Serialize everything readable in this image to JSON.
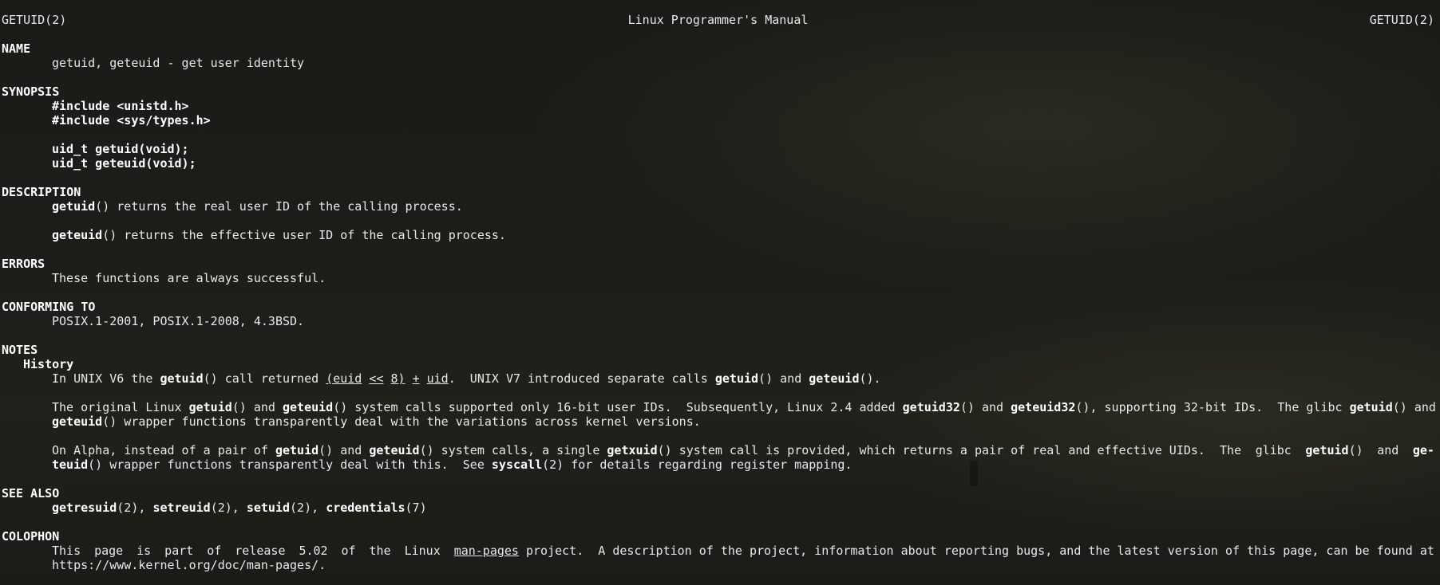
{
  "header": {
    "left": "GETUID(2)",
    "center": "Linux Programmer's Manual",
    "right": "GETUID(2)"
  },
  "name": {
    "title": "NAME",
    "text": "getuid, geteuid - get user identity"
  },
  "synopsis": {
    "title": "SYNOPSIS",
    "include1": "#include <unistd.h>",
    "include2": "#include <sys/types.h>",
    "proto1": "uid_t getuid(void);",
    "proto2": "uid_t geteuid(void);"
  },
  "description": {
    "title": "DESCRIPTION",
    "p1_fn": "getuid",
    "p1_rest": "() returns the real user ID of the calling process.",
    "p2_fn": "geteuid",
    "p2_rest": "() returns the effective user ID of the calling process."
  },
  "errors": {
    "title": "ERRORS",
    "text": "These functions are always successful."
  },
  "conforming": {
    "title": "CONFORMING TO",
    "text": "POSIX.1-2001, POSIX.1-2008, 4.3BSD."
  },
  "notes": {
    "title": "NOTES",
    "subtitle": "History",
    "h1": {
      "a": "In UNIX V6 the ",
      "fn1": "getuid",
      "b": "() call returned ",
      "u1": "(euid",
      "s1": " ",
      "u2": "<<",
      "s2": " ",
      "u3": "8)",
      "s3": " ",
      "u4": "+",
      "s4": " ",
      "u5": "uid",
      "c": ".  UNIX V7 introduced separate calls ",
      "fn2": "getuid",
      "d": "() and ",
      "fn3": "geteuid",
      "e": "()."
    },
    "p2": {
      "l1_a": "The original Linux ",
      "l1_fn1": "getuid",
      "l1_b": "() and ",
      "l1_fn2": "geteuid",
      "l1_c": "() system calls supported only 16-bit user IDs.  Subsequently, Linux 2.4 added ",
      "l1_fn3": "getuid32",
      "l1_d": "() and ",
      "l1_fn4": "geteuid32",
      "l1_e": "(), supporting 32-bit IDs.  The glibc ",
      "l1_fn5": "getuid",
      "l1_f": "() and",
      "l2_fn": "geteuid",
      "l2_rest": "() wrapper functions transparently deal with the variations across kernel versions."
    },
    "p3": {
      "w1": "On Alpha, instead of a pair of ",
      "fn1": "getuid",
      "w2": "() and ",
      "fn2": "geteuid",
      "w3": "() system calls, a single ",
      "fn3": "getxuid",
      "w4": "() system call is provided, which returns a pair of real and effective UIDs.  The",
      "w5": "glibc",
      "fn4": "getuid",
      "w6": "()",
      "w7": "and",
      "fn5": "ge-",
      "l2_fn": "teuid",
      "l2_a": "() wrapper functions transparently deal with this.  See ",
      "l2_fn2": "syscall",
      "l2_b": "(2) for details regarding register mapping."
    }
  },
  "see_also": {
    "title": "SEE ALSO",
    "fn1": "getresuid",
    "s1": "(2), ",
    "fn2": "setreuid",
    "s2": "(2), ",
    "fn3": "setuid",
    "s3": "(2), ",
    "fn4": "credentials",
    "s4": "(7)"
  },
  "colophon": {
    "title": "COLOPHON",
    "words": [
      "This",
      "page",
      "is",
      "part",
      "of",
      "release",
      "5.02",
      "of",
      "the",
      "Linux"
    ],
    "link": "man-pages",
    "rest": "project.  A description of the project, information about reporting bugs, and the latest version of this page, can be found at",
    "url": "https://www.kernel.org/doc/man-pages/."
  },
  "colors": {
    "text": "#e8e8e8",
    "bold": "#ffffff",
    "background": "#1c1c18"
  }
}
